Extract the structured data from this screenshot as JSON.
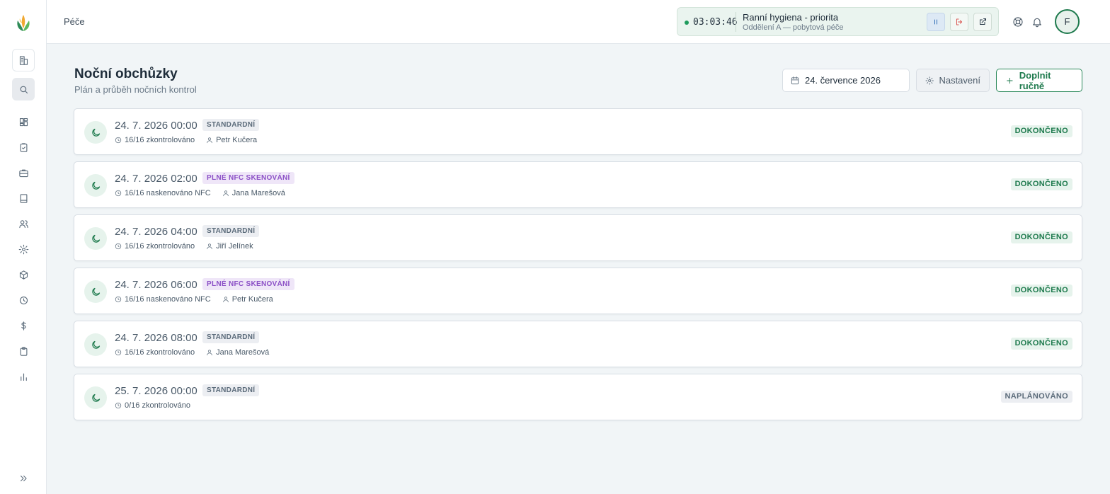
{
  "header": {
    "breadcrumb": "Péče",
    "timer": {
      "time": "03:03:46",
      "task": "Ranní hygiena - priorita",
      "department": "Oddělení A — pobytová péče"
    },
    "avatar_initial": "F"
  },
  "page": {
    "title": "Noční obchůzky",
    "subtitle": "Plán a průběh nočních kontrol",
    "date": "24. července 2026",
    "settings_label": "Nastavení",
    "add_label": "Doplnit ručně"
  },
  "rounds": [
    {
      "time": "24. 7. 2026 00:00",
      "tag": "STANDARDNÍ",
      "tag_kind": "std",
      "progress": "16/16 zkontrolováno",
      "person": "Petr Kučera",
      "status": "DOKONČENO",
      "status_kind": "done"
    },
    {
      "time": "24. 7. 2026 02:00",
      "tag": "PLNÉ NFC SKENOVÁNÍ",
      "tag_kind": "nfc",
      "progress": "16/16 naskenováno NFC",
      "person": "Jana Marešová",
      "status": "DOKONČENO",
      "status_kind": "done"
    },
    {
      "time": "24. 7. 2026 04:00",
      "tag": "STANDARDNÍ",
      "tag_kind": "std",
      "progress": "16/16 zkontrolováno",
      "person": "Jiří Jelínek",
      "status": "DOKONČENO",
      "status_kind": "done"
    },
    {
      "time": "24. 7. 2026 06:00",
      "tag": "PLNÉ NFC SKENOVÁNÍ",
      "tag_kind": "nfc",
      "progress": "16/16 naskenováno NFC",
      "person": "Petr Kučera",
      "status": "DOKONČENO",
      "status_kind": "done"
    },
    {
      "time": "24. 7. 2026 08:00",
      "tag": "STANDARDNÍ",
      "tag_kind": "std",
      "progress": "16/16 zkontrolováno",
      "person": "Jana Marešová",
      "status": "DOKONČENO",
      "status_kind": "done"
    },
    {
      "time": "25. 7. 2026 00:00",
      "tag": "STANDARDNÍ",
      "tag_kind": "std",
      "progress": "0/16 zkontrolováno",
      "person": "",
      "status": "NAPLÁNOVÁNO",
      "status_kind": "planned"
    }
  ],
  "colors": {
    "accent": "#1e7a4d",
    "nfc": "#8b4fc6",
    "background": "#f1f5f7"
  },
  "sidebar": {
    "icons": [
      "building-icon",
      "search-icon",
      "dashboard-icon",
      "clipboard-check-icon",
      "briefcase-icon",
      "book-icon",
      "users-icon",
      "gear-icon",
      "box-icon",
      "clock-icon",
      "dollar-icon",
      "clipboard-icon",
      "bar-chart-icon"
    ]
  }
}
